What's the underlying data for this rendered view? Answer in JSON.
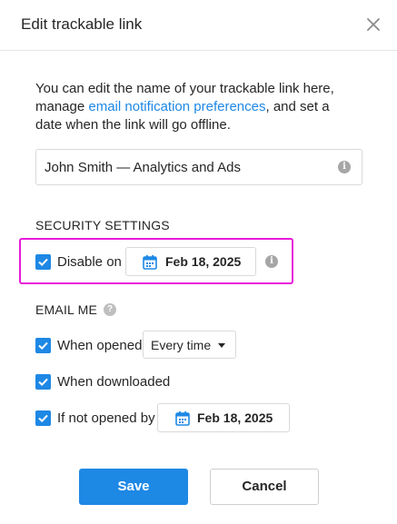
{
  "dialog": {
    "title": "Edit trackable link",
    "intro_before": "You can edit the name of your trackable link here, manage ",
    "intro_link": "email notification preferences",
    "intro_after": ", and set a date when the link will go offline.",
    "link_name_value": "John Smith — Analytics and Ads"
  },
  "security": {
    "heading": "SECURITY SETTINGS",
    "disable_label": "Disable on",
    "disable_checked": true,
    "disable_date": "Feb 18, 2025"
  },
  "email_me": {
    "heading": "EMAIL ME",
    "when_opened_label": "When opened",
    "when_opened_checked": true,
    "frequency_selected": "Every time",
    "when_downloaded_label": "When downloaded",
    "when_downloaded_checked": true,
    "not_opened_label": "If not opened by",
    "not_opened_checked": true,
    "not_opened_date": "Feb 18, 2025"
  },
  "actions": {
    "save_label": "Save",
    "cancel_label": "Cancel"
  },
  "colors": {
    "accent": "#1e88e5",
    "highlight_border": "#e81ad8"
  },
  "icons": {
    "close": "close-icon",
    "info": "info-icon",
    "calendar": "calendar-icon",
    "help": "help-icon",
    "check": "check-icon",
    "caret": "caret-down-icon"
  }
}
